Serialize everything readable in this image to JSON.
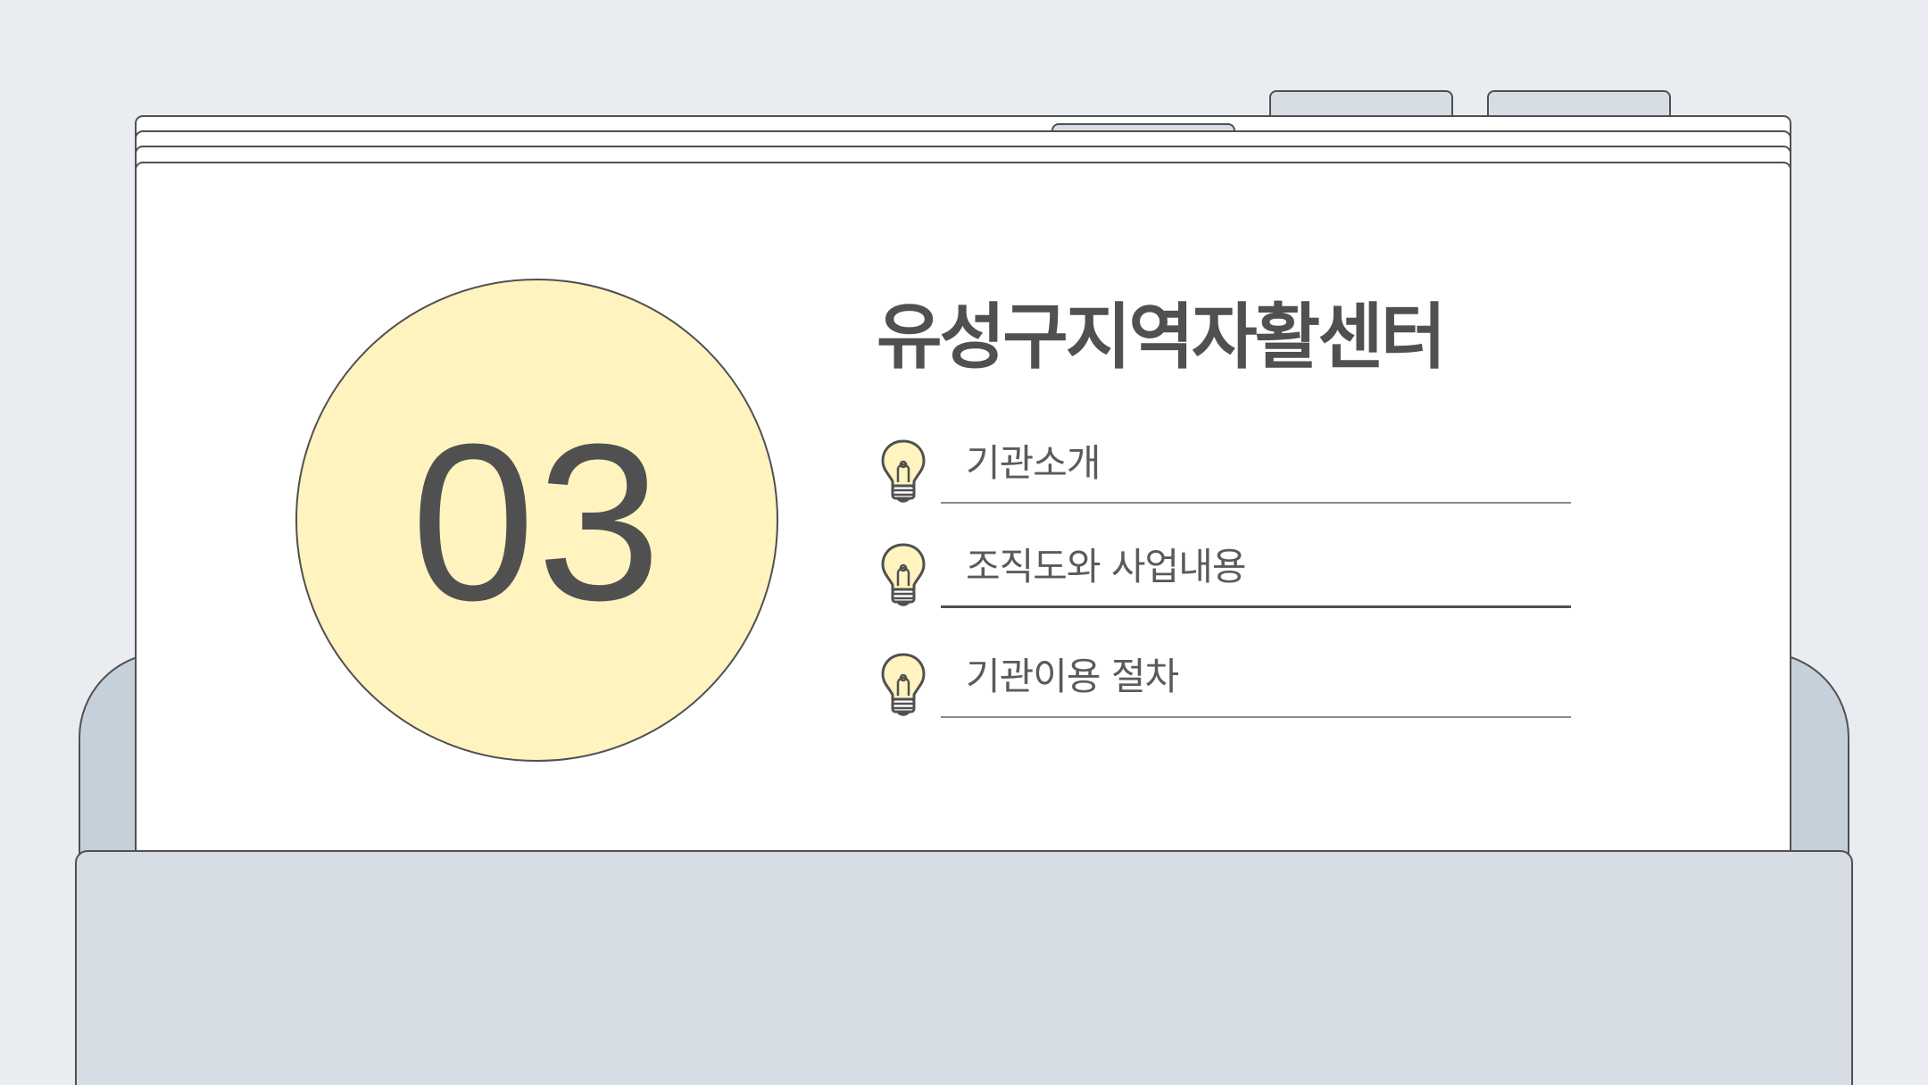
{
  "section": {
    "number": "03",
    "title": "유성구지역자활센터"
  },
  "menu": {
    "items": [
      {
        "label": "기관소개",
        "icon": "lightbulb-icon"
      },
      {
        "label": "조직도와 사업내용",
        "icon": "lightbulb-icon"
      },
      {
        "label": "기관이용 절차",
        "icon": "lightbulb-icon"
      }
    ]
  },
  "colors": {
    "background": "#e9edf1",
    "circle_fill": "#fff3bf",
    "outline": "#505050",
    "folder": "#d6dde5",
    "folder_back": "#c6d0db",
    "sheet": "#ffffff"
  }
}
